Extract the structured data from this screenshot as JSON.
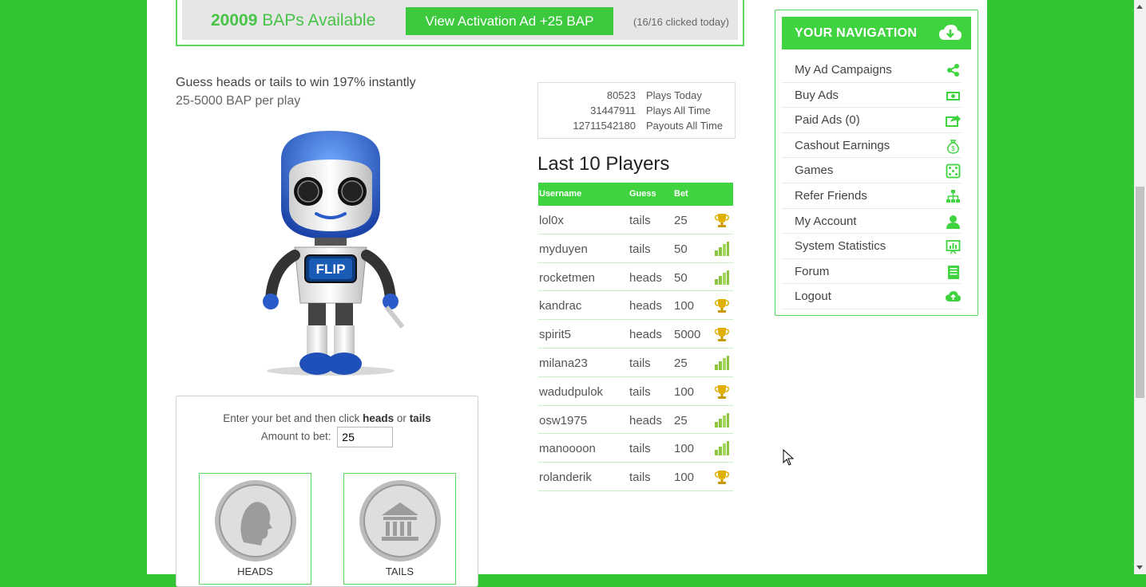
{
  "bap_bar": {
    "count": "20009",
    "count_suffix": " BAPs Available",
    "button_label": "View Activation Ad +25 BAP",
    "clicks_text": "(16/16 clicked today)"
  },
  "intro": {
    "headline": "Guess heads or tails to win 197% instantly",
    "range": "25-5000 BAP per play"
  },
  "robot": {
    "badge": "FLIP"
  },
  "bet": {
    "line_prefix": "Enter your bet and then click ",
    "heads_word": "heads",
    "or_word": " or ",
    "tails_word": "tails",
    "amount_label": "Amount to bet:",
    "amount_value": "25",
    "heads_label": "HEADS",
    "tails_label": "TAILS"
  },
  "stats": [
    {
      "value": "80523",
      "label": "Plays  Today"
    },
    {
      "value": "31447911",
      "label": "Plays  All Time"
    },
    {
      "value": "12711542180",
      "label": "Payouts All Time"
    }
  ],
  "players": {
    "title": "Last 10 Players",
    "headers": [
      "Username",
      "Guess",
      "Bet"
    ],
    "rows": [
      {
        "user": "lol0x",
        "guess": "tails",
        "bet": "25",
        "result": "trophy"
      },
      {
        "user": "myduyen",
        "guess": "tails",
        "bet": "50",
        "result": "bars"
      },
      {
        "user": "rocketmen",
        "guess": "heads",
        "bet": "50",
        "result": "bars"
      },
      {
        "user": "kandrac",
        "guess": "heads",
        "bet": "100",
        "result": "trophy"
      },
      {
        "user": "spirit5",
        "guess": "heads",
        "bet": "5000",
        "result": "trophy"
      },
      {
        "user": "milana23",
        "guess": "tails",
        "bet": "25",
        "result": "bars"
      },
      {
        "user": "wadudpulok",
        "guess": "tails",
        "bet": "100",
        "result": "trophy"
      },
      {
        "user": "osw1975",
        "guess": "heads",
        "bet": "25",
        "result": "bars"
      },
      {
        "user": "manoooon",
        "guess": "tails",
        "bet": "100",
        "result": "bars"
      },
      {
        "user": "rolanderik",
        "guess": "tails",
        "bet": "100",
        "result": "trophy"
      }
    ]
  },
  "nav": {
    "title": "YOUR NAVIGATION",
    "items": [
      {
        "label": "My Ad Campaigns",
        "icon": "share-icon"
      },
      {
        "label": "Buy Ads",
        "icon": "money-icon"
      },
      {
        "label": "Paid Ads (0)",
        "icon": "forward-icon"
      },
      {
        "label": "Cashout Earnings",
        "icon": "money-bag-icon"
      },
      {
        "label": "Games",
        "icon": "dice-icon"
      },
      {
        "label": "Refer Friends",
        "icon": "sitemap-icon"
      },
      {
        "label": "My Account",
        "icon": "user-icon"
      },
      {
        "label": "System Statistics",
        "icon": "presentation-icon"
      },
      {
        "label": "Forum",
        "icon": "book-icon"
      },
      {
        "label": "Logout",
        "icon": "cloud-upload-icon"
      }
    ]
  },
  "colors": {
    "brand_green": "#3fd33f",
    "background_green": "#33c433",
    "accent_text_green": "#47c447"
  }
}
